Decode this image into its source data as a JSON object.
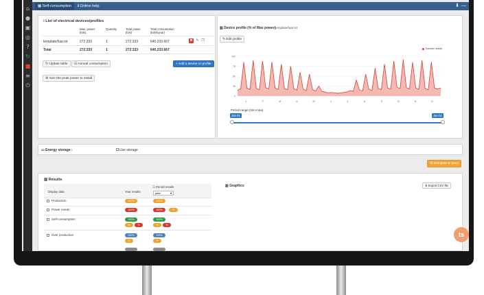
{
  "topbar": {
    "tabs": [
      {
        "label": "Self-consumption"
      },
      {
        "label": "Online help"
      }
    ]
  },
  "devices": {
    "title": "List of electrical devices/profiles",
    "columns": [
      "Max. power (kW)",
      "Quantity",
      "Total power (kW)",
      "Total consumption (kWh/year)"
    ],
    "col_units": [
      "(kW)",
      "",
      "(kW)",
      "(kWh/year)"
    ],
    "col_names": [
      "Max. power",
      "Quantity",
      "Total power",
      "Total consumption"
    ],
    "rows": [
      {
        "name": "template/fuar.txt",
        "max_power": "272.333",
        "quantity": "1",
        "total_power": "272.333",
        "total_consumption": "640,233.667"
      },
      {
        "name": "Total",
        "max_power": "272.333",
        "quantity": "1",
        "total_power": "272.333",
        "total_consumption": "640,233.667"
      }
    ],
    "update_btn": "Update table",
    "annual_btn": "Annual consumption",
    "add_btn": "+ Add a device or profile",
    "size_btn": "Size the peak power to install"
  },
  "profile": {
    "title": "Device profile (% of Max power)",
    "file": "template/fuar.txt",
    "edit_btn": "Edit profile",
    "legend": "Device needs",
    "period_label": "Period range (min-max)",
    "range_start": "Jan 01",
    "range_end": "Jan 01"
  },
  "chart_data": {
    "type": "area",
    "title": "",
    "xlabel": "",
    "ylabel": "",
    "ylim": [
      0,
      100
    ],
    "yticks": [
      0,
      25,
      50,
      75,
      100
    ],
    "x_ticks": [
      "J",
      "F",
      "M",
      "A",
      "M",
      "J",
      "J",
      "A",
      "S",
      "O",
      "N",
      "D"
    ],
    "series": [
      {
        "name": "Device needs",
        "color": "#d94035",
        "values": [
          15,
          18,
          85,
          20,
          17,
          90,
          19,
          16,
          88,
          21,
          18,
          86,
          20,
          17,
          80,
          19,
          16,
          75,
          18,
          15,
          60,
          17,
          14,
          55,
          16,
          13,
          25,
          12,
          10,
          8,
          9,
          8,
          7,
          8,
          9,
          10,
          14,
          12,
          40,
          15,
          13,
          55,
          17,
          14,
          70,
          19,
          16,
          80,
          20,
          18,
          88,
          22,
          19,
          92,
          21,
          18,
          85,
          20,
          17,
          90,
          19,
          16,
          86,
          20,
          18,
          20
        ]
      }
    ]
  },
  "storage": {
    "title": "Energy storage :",
    "use_label": "Use storage",
    "compute_btn": "Compute & Save"
  },
  "results": {
    "title": "Results",
    "col_display": "Display data",
    "col_year": "Year results",
    "col_period": "Period results",
    "period_select": "year",
    "rows": [
      {
        "label": "Production",
        "year": [
          "100%"
        ],
        "period": [
          "100%"
        ]
      },
      {
        "label": "Power needs",
        "year": [
          "100%"
        ],
        "period": [
          "100%",
          "%"
        ]
      },
      {
        "label": "Self-consumption",
        "year": [
          "100%",
          "%",
          "%"
        ],
        "period": [
          "100%",
          "%",
          "%"
        ]
      },
      {
        "label": "Over production",
        "year": [
          "100%",
          "%"
        ],
        "period": [
          "100%",
          "%"
        ]
      }
    ],
    "graphics_title": "Graphics",
    "export_btn": "Export CSV file"
  },
  "logo": "ts"
}
